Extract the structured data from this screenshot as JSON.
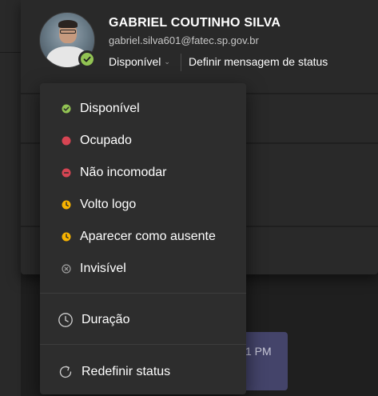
{
  "profile": {
    "name": "GABRIEL COUTINHO SILVA",
    "email": "gabriel.silva601@fatec.sp.gov.br",
    "current_status": "Disponível",
    "set_status_message": "Definir mensagem de status"
  },
  "status_menu": {
    "items": [
      {
        "label": "Disponível",
        "icon": "available-icon",
        "color": "#92c353"
      },
      {
        "label": "Ocupado",
        "icon": "busy-icon",
        "color": "#d74553"
      },
      {
        "label": "Não incomodar",
        "icon": "do-not-disturb-icon",
        "color": "#d74553"
      },
      {
        "label": "Volto logo",
        "icon": "be-right-back-clock-icon",
        "color": "#f8b300"
      },
      {
        "label": "Aparecer como ausente",
        "icon": "away-clock-icon",
        "color": "#f8b300"
      },
      {
        "label": "Invisível",
        "icon": "offline-x-icon",
        "color": "#a0a0a0"
      }
    ],
    "duration_label": "Duração",
    "reset_label": "Redefinir status"
  },
  "background": {
    "message_time": "1 PM"
  },
  "colors": {
    "available": "#92c353",
    "busy": "#d74553",
    "away": "#f8b300",
    "menu_bg": "#2d2d2d",
    "card_bg": "#292929"
  }
}
